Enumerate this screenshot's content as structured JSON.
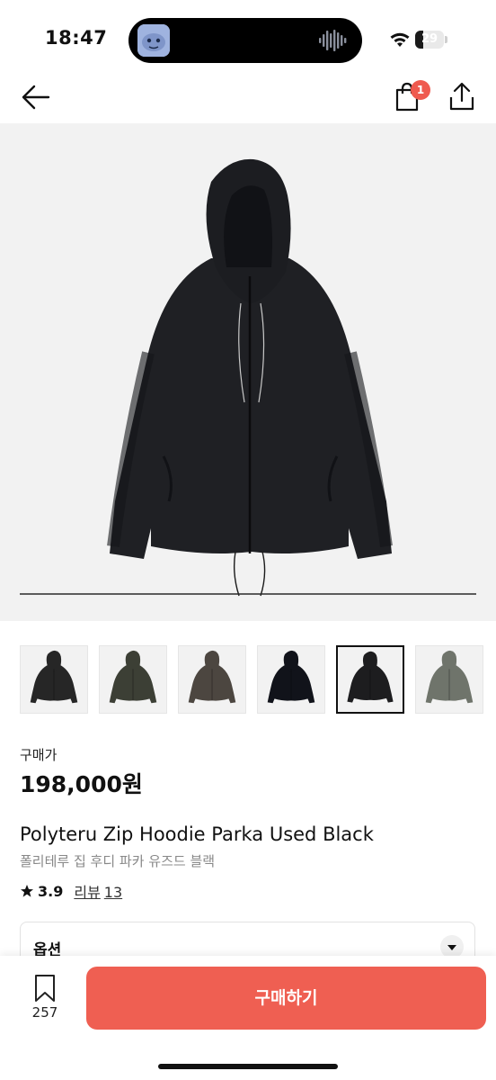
{
  "status_bar": {
    "time": "18:47",
    "battery_level": "29",
    "battery_fraction": 0.29,
    "icons": [
      "wifi-icon",
      "battery-icon",
      "audio-wave-icon"
    ]
  },
  "nav": {
    "cart_badge": "1",
    "icons": [
      "back-arrow-icon",
      "shopping-bag-icon",
      "share-icon"
    ]
  },
  "product": {
    "price_label": "구매가",
    "price": "198,000원",
    "title_en": "Polyteru Zip Hoodie Parka Used Black",
    "title_ko": "폴리테루 집 후디 파카 유즈드 블랙",
    "rating": "3.9",
    "review_label": "리뷰",
    "review_count": "13"
  },
  "thumbnails": {
    "colors": [
      "#262626",
      "#3c3f35",
      "#4c4640",
      "#11131a",
      "#1d1d1f",
      "#6f746b"
    ],
    "selected_index": 4
  },
  "options": {
    "label": "옵션"
  },
  "bottom_bar": {
    "bookmark_count": "257",
    "buy_label": "구매하기"
  },
  "colors": {
    "accent": "#ef5f52",
    "badge": "#ef5a4f"
  }
}
